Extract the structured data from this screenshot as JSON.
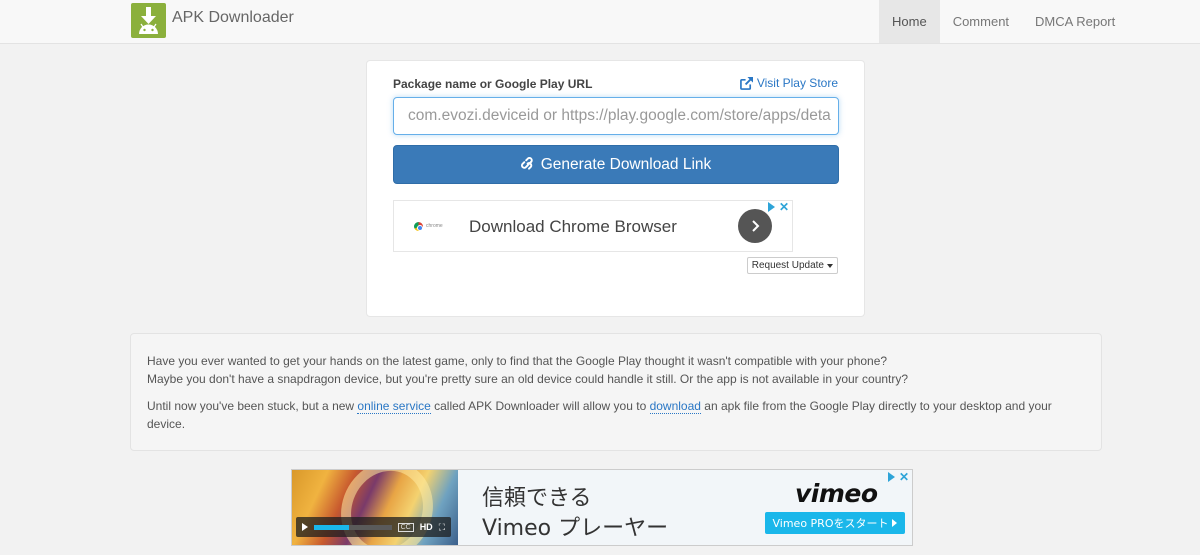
{
  "navbar": {
    "brand": "APK Downloader",
    "links": [
      {
        "label": "Home",
        "active": true
      },
      {
        "label": "Comment",
        "active": false
      },
      {
        "label": "DMCA Report",
        "active": false
      }
    ]
  },
  "form": {
    "label": "Package name or Google Play URL",
    "store_link": "Visit Play Store",
    "input_placeholder": "com.evozi.deviceid or https://play.google.com/store/apps/deta",
    "button_label": "Generate Download Link",
    "request_update": "Request Update"
  },
  "ad_top": {
    "brand_mini": "chrome",
    "title": "Download Chrome Browser"
  },
  "info": {
    "p1_line1": "Have you ever wanted to get your hands on the latest game, only to find that the Google Play thought it wasn't compatible with your phone?",
    "p1_line2": "Maybe you don't have a snapdragon device, but you're pretty sure an old device could handle it still. Or the app is not available in your country?",
    "p2_part1": "Until now you've been stuck, but a new ",
    "p2_link1": "online service",
    "p2_part2": " called APK Downloader will allow you to ",
    "p2_link2": "download",
    "p2_part3": " an apk file from the Google Play directly to your desktop and your device."
  },
  "banner": {
    "line1": "信頼できる",
    "line2": "Vimeo プレーヤー",
    "logo": "vimeo",
    "button": "Vimeo PROをスタート",
    "player_hd": "HD",
    "player_cc": "CC",
    "progress": 0.45
  },
  "colors": {
    "accent": "#3a7ab8",
    "link": "#2a77c5",
    "logo_green": "#8bb03c",
    "vimeo_blue": "#1ab7ea"
  }
}
